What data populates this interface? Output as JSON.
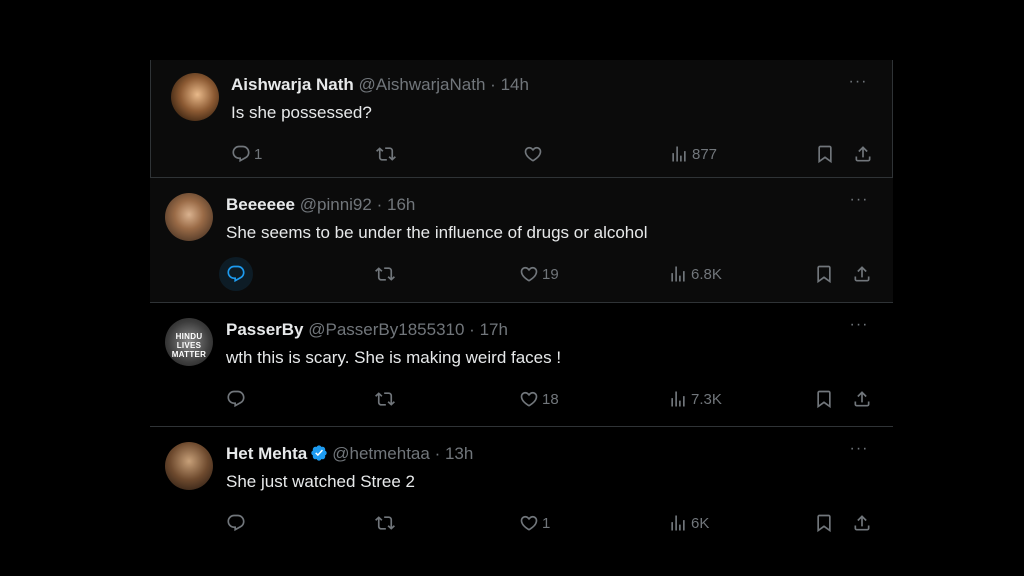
{
  "tweets": [
    {
      "name": "Aishwarja Nath",
      "handle": "@AishwarjaNath",
      "time": "14h",
      "text": "Is she possessed?",
      "verified": false,
      "replies": "1",
      "retweets": "",
      "likes": "",
      "views": "877"
    },
    {
      "name": "Beeeeee",
      "handle": "@pinni92",
      "time": "16h",
      "text": "She seems to be under the influence of drugs or alcohol",
      "verified": false,
      "replies": "",
      "retweets": "",
      "likes": "19",
      "views": "6.8K"
    },
    {
      "name": "PasserBy",
      "handle": "@PasserBy1855310",
      "time": "17h",
      "text": "wth this is scary. She is making weird faces !",
      "verified": false,
      "avatar_text": "HINDU LIVES MATTER",
      "replies": "",
      "retweets": "",
      "likes": "18",
      "views": "7.3K"
    },
    {
      "name": "Het Mehta",
      "handle": "@hetmehtaa",
      "time": "13h",
      "text": "She just watched Stree 2",
      "verified": true,
      "replies": "",
      "retweets": "",
      "likes": "1",
      "views": "6K"
    }
  ],
  "separator": "·",
  "more_glyph": "···",
  "colors": {
    "background": "#000000",
    "text_primary": "#e7e9ea",
    "text_secondary": "#71767b",
    "border": "#2f3336",
    "accent": "#1d9bf0"
  },
  "icons": [
    "reply-icon",
    "retweet-icon",
    "like-icon",
    "views-icon",
    "bookmark-icon",
    "share-icon",
    "more-icon",
    "verified-badge-icon"
  ]
}
